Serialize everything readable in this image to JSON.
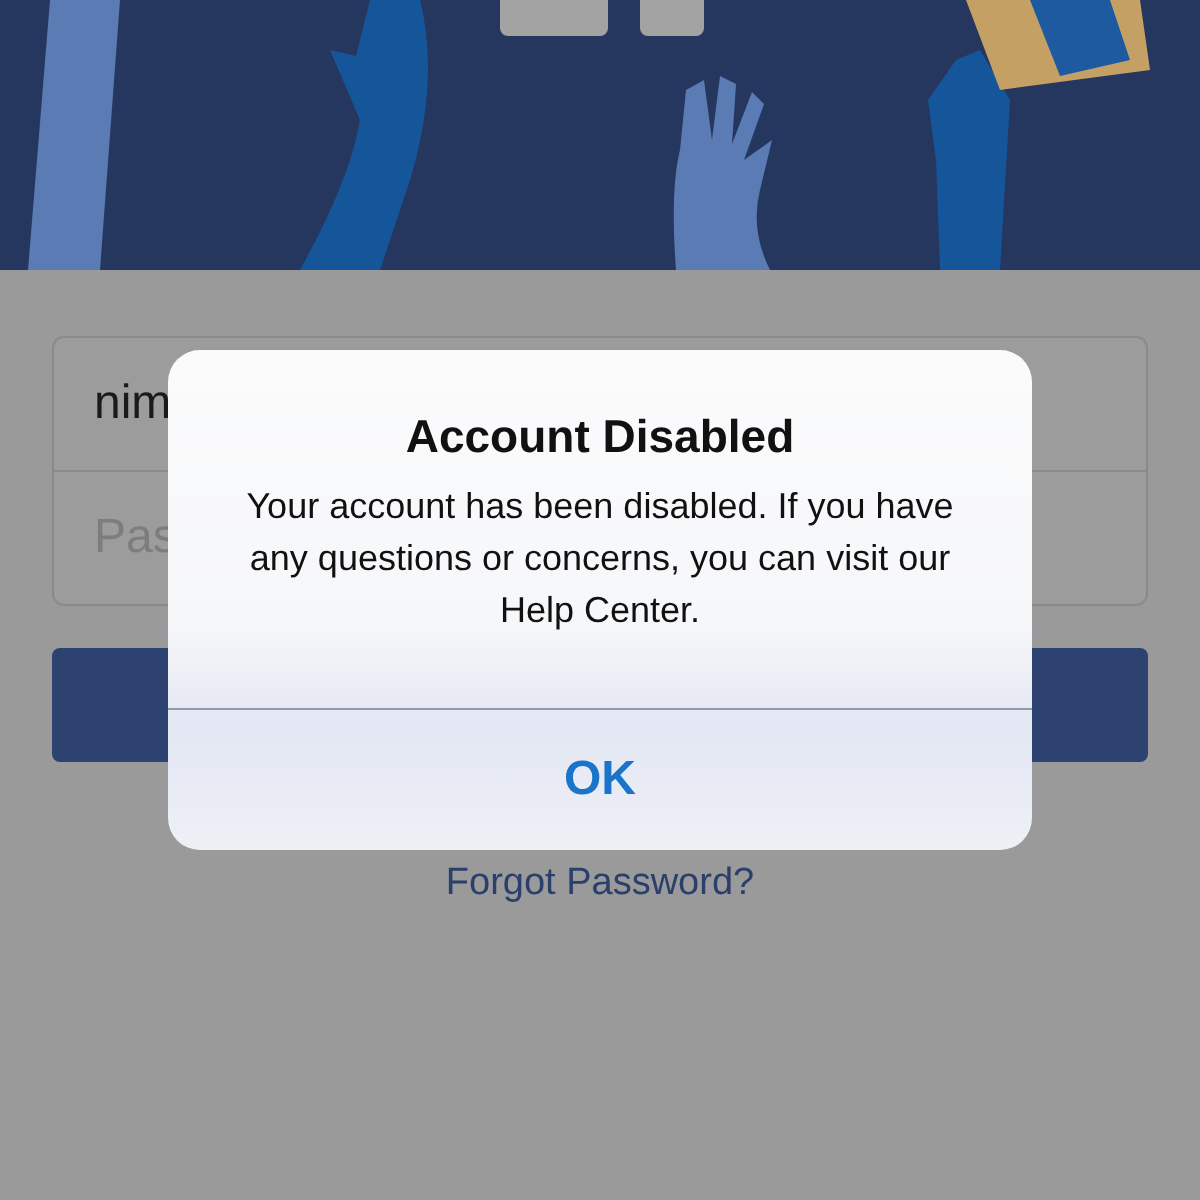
{
  "form": {
    "username": {
      "value": "nim"
    },
    "password": {
      "placeholder": "Pas"
    }
  },
  "forgot_password": "Forgot Password?",
  "alert": {
    "title": "Account Disabled",
    "message": "Your account has been disabled. If you have any questions or concerns, you can visit our Help Center.",
    "buttons": [
      {
        "label": "OK"
      }
    ]
  }
}
